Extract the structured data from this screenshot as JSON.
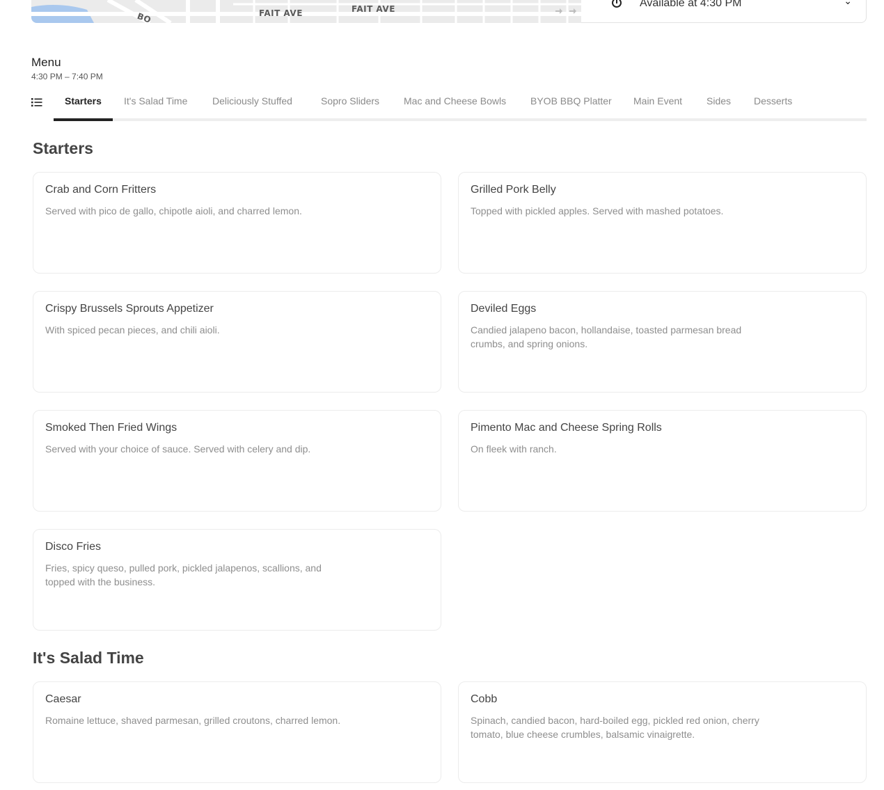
{
  "map": {
    "street_labels": [
      "FAIT AVE",
      "FAIT AVE",
      "BO"
    ]
  },
  "availability": {
    "text": "Available at 4:30 PM"
  },
  "menu": {
    "title": "Menu",
    "hours": "4:30 PM – 7:40 PM"
  },
  "tabs": [
    {
      "label": "Starters",
      "active": true
    },
    {
      "label": "It's Salad Time"
    },
    {
      "label": "Deliciously Stuffed"
    },
    {
      "label": "Sopro Sliders"
    },
    {
      "label": "Mac and Cheese Bowls"
    },
    {
      "label": "BYOB BBQ Platter"
    },
    {
      "label": "Main Event"
    },
    {
      "label": "Sides"
    },
    {
      "label": "Desserts"
    }
  ],
  "sections": [
    {
      "title": "Starters",
      "items": [
        {
          "name": "Crab and Corn Fritters",
          "description": "Served with pico de gallo, chipotle aioli, and charred lemon."
        },
        {
          "name": "Grilled Pork Belly",
          "description": "Topped with pickled apples. Served with mashed potatoes."
        },
        {
          "name": "Crispy Brussels Sprouts Appetizer",
          "description": "With spiced pecan pieces, and chili aioli."
        },
        {
          "name": "Deviled Eggs",
          "description": "Candied jalapeno bacon, hollandaise, toasted parmesan bread crumbs, and spring onions."
        },
        {
          "name": "Smoked Then Fried Wings",
          "description": "Served with your choice of sauce. Served with celery and dip."
        },
        {
          "name": "Pimento Mac and Cheese Spring Rolls",
          "description": "On fleek with ranch."
        },
        {
          "name": "Disco Fries",
          "description": "Fries, spicy queso, pulled pork, pickled jalapenos, scallions, and topped with the business."
        }
      ]
    },
    {
      "title": "It's Salad Time",
      "items": [
        {
          "name": "Caesar",
          "description": "Romaine lettuce, shaved parmesan, grilled croutons, charred lemon."
        },
        {
          "name": "Cobb",
          "description": "Spinach, candied bacon, hard-boiled egg, pickled red onion, cherry tomato, blue cheese crumbles, balsamic vinaigrette."
        }
      ]
    }
  ]
}
